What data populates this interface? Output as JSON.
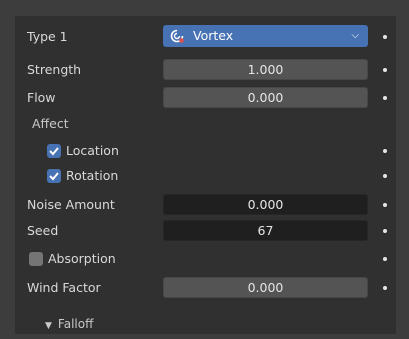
{
  "type1": {
    "label": "Type 1",
    "value": "Vortex",
    "icon": "vortex-icon",
    "accent": "#4772b3"
  },
  "strength": {
    "label": "Strength",
    "value": "1.000"
  },
  "flow": {
    "label": "Flow",
    "value": "0.000"
  },
  "affect": {
    "label": "Affect",
    "location": {
      "label": "Location",
      "checked": true
    },
    "rotation": {
      "label": "Rotation",
      "checked": true
    }
  },
  "noise_amount": {
    "label": "Noise Amount",
    "value": "0.000"
  },
  "seed": {
    "label": "Seed",
    "value": "67"
  },
  "absorption": {
    "label": "Absorption",
    "checked": false
  },
  "wind_factor": {
    "label": "Wind Factor",
    "value": "0.000"
  },
  "falloff": {
    "label": "Falloff",
    "expanded": true
  }
}
